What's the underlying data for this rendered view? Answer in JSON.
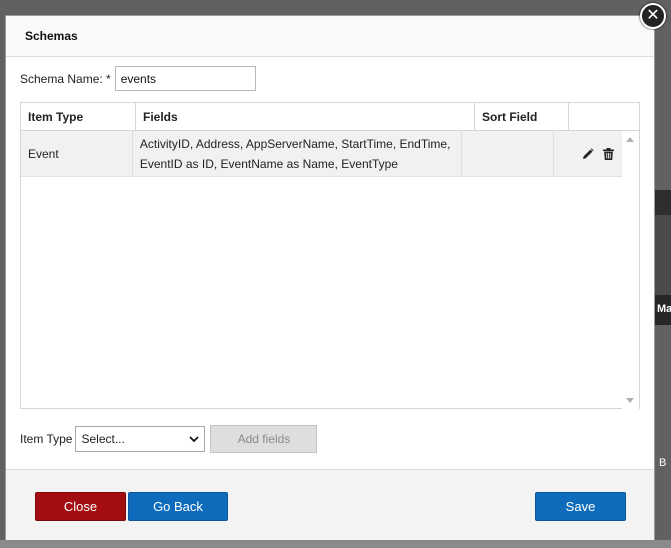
{
  "modal": {
    "title": "Schemas",
    "close_glyph": "✕",
    "schema_name": {
      "label": "Schema Name: *",
      "value": "events"
    },
    "grid": {
      "columns": [
        "Item Type",
        "Fields",
        "Sort Field",
        ""
      ],
      "rows": [
        {
          "item_type": "Event",
          "fields_line1": "ActivityID, Address, AppServerName, StartTime, EndTime,",
          "fields_line2": "EventID as ID, EventName as Name, EventType",
          "sort_field": "",
          "actions": [
            "pencil-icon",
            "trash-icon"
          ]
        }
      ]
    },
    "item_type_picker": {
      "label": "Item Type",
      "selected": "Select...",
      "add_label": "Add fields"
    },
    "footer": {
      "close_label": "Close",
      "back_label": "Go Back",
      "save_label": "Save"
    }
  },
  "background": {
    "fragment_ma": "Ma",
    "fragment_b": "B"
  },
  "colors": {
    "close_btn": "#a30d12",
    "primary_btn": "#0f6cbd",
    "disabled_btn": "#dedede"
  }
}
